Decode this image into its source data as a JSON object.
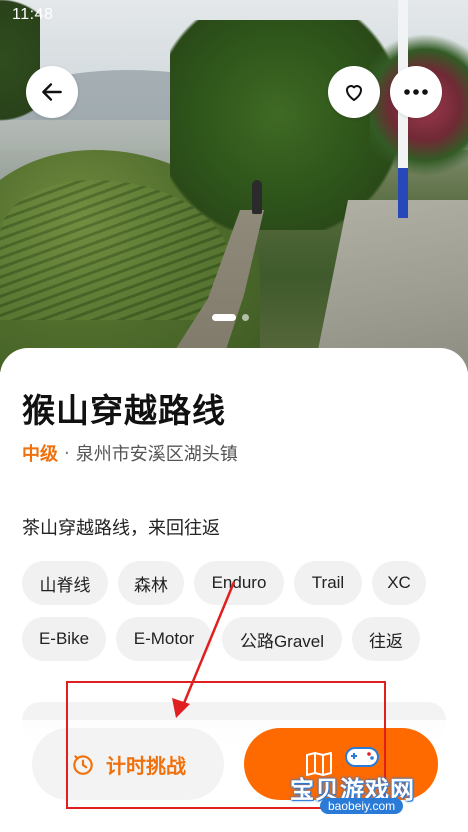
{
  "status_bar": {
    "time": "11:48"
  },
  "hero": {
    "image_desc_icon": "landscape-photo"
  },
  "top_actions": {
    "back_icon": "arrow-left-icon",
    "favorite_icon": "heart-outline-icon",
    "more_icon": "ellipsis-icon"
  },
  "carousel": {
    "pages": 2,
    "active": 1
  },
  "route": {
    "title": "猴山穿越路线",
    "level": "中级",
    "separator": "·",
    "location": "泉州市安溪区湖头镇",
    "description": "茶山穿越路线，来回往返"
  },
  "tags": [
    "山脊线",
    "森林",
    "Enduro",
    "Trail",
    "XC",
    "E-Bike",
    "E-Motor",
    "公路Gravel",
    "往返"
  ],
  "bottom_actions": {
    "timer_label": "计时挑战",
    "timer_icon": "stopwatch-icon",
    "navigate_icon": "map-book-icon"
  },
  "colors": {
    "accent": "#f0700c",
    "primary_button": "#ff6a00",
    "tag_bg": "#f1f1f1",
    "annotation": "#e02020"
  },
  "watermark": {
    "text": "宝贝游戏网",
    "url": "baobeiy.com"
  }
}
